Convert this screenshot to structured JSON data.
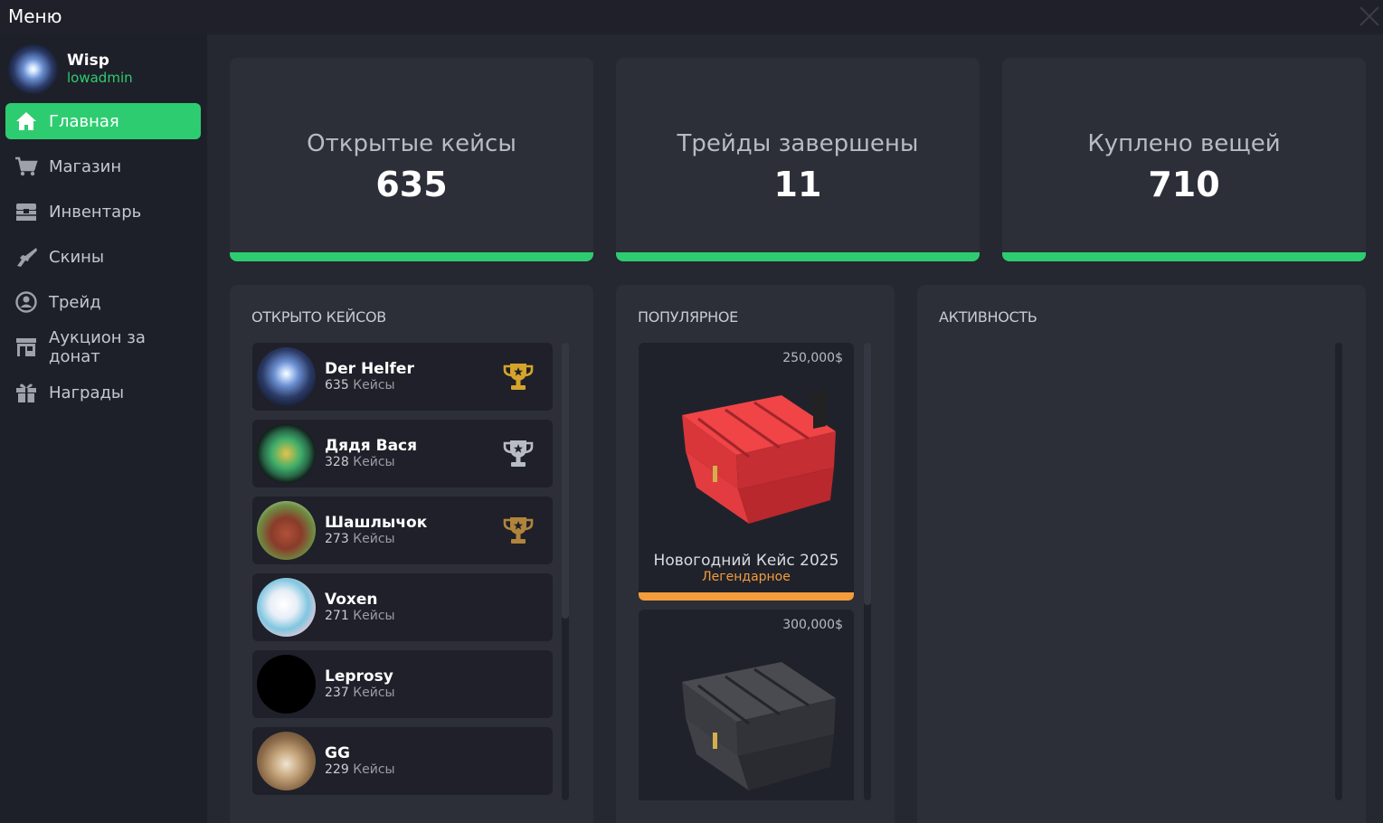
{
  "window": {
    "title": "Меню"
  },
  "user": {
    "name": "Wisp",
    "role": "lowadmin"
  },
  "nav": [
    {
      "label": "Главная",
      "icon": "home-icon",
      "active": true
    },
    {
      "label": "Магазин",
      "icon": "cart-icon"
    },
    {
      "label": "Инвентарь",
      "icon": "chest-icon"
    },
    {
      "label": "Скины",
      "icon": "gun-icon"
    },
    {
      "label": "Трейд",
      "icon": "user-circle-icon"
    },
    {
      "label": "Аукцион за донат",
      "icon": "shop-icon"
    },
    {
      "label": "Награды",
      "icon": "gift-icon"
    }
  ],
  "stats": [
    {
      "label": "Открытые кейсы",
      "value": "635"
    },
    {
      "label": "Трейды завершены",
      "value": "11"
    },
    {
      "label": "Куплено вещей",
      "value": "710"
    }
  ],
  "opened_cases": {
    "title": "ОТКРЫТО КЕЙСОВ",
    "unit": "Кейсы",
    "rows": [
      {
        "name": "Der Helfer",
        "count": "635",
        "trophy": "gold",
        "avatar": "galaxy"
      },
      {
        "name": "Дядя Вася",
        "count": "328",
        "trophy": "silver",
        "avatar": "mask"
      },
      {
        "name": "Шашлычок",
        "count": "273",
        "trophy": "bronze",
        "avatar": "kebab"
      },
      {
        "name": "Voxen",
        "count": "271",
        "trophy": "",
        "avatar": "anime"
      },
      {
        "name": "Leprosy",
        "count": "237",
        "trophy": "",
        "avatar": "black"
      },
      {
        "name": "GG",
        "count": "229",
        "trophy": "",
        "avatar": "cat"
      }
    ]
  },
  "popular": {
    "title": "ПОПУЛЯРНОЕ",
    "cards": [
      {
        "price": "250,000$",
        "name": "Новогодний Кейс 2025",
        "rarity": "Легендарное",
        "color": "#e8383d"
      },
      {
        "price": "300,000$",
        "name": "",
        "rarity": "",
        "color": "#3a3b3f"
      }
    ]
  },
  "activity": {
    "title": "АКТИВНОСТЬ"
  },
  "colors": {
    "accent": "#2ecc71",
    "legendary": "#f39c3c",
    "gold": "#d4a52a",
    "silver": "#b8bcc4",
    "bronze": "#b0843c"
  }
}
